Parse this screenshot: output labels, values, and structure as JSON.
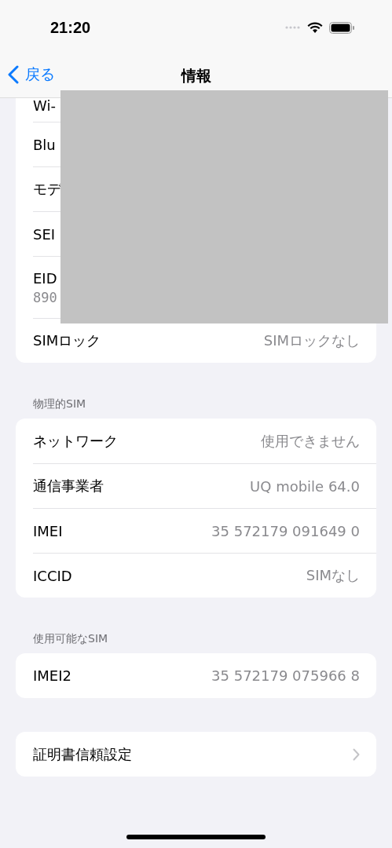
{
  "status_bar": {
    "time": "21:20"
  },
  "nav": {
    "back_label": "戻る",
    "title": "情報"
  },
  "sections": [
    {
      "rows": [
        {
          "kind": "value",
          "label": "Wi-"
        },
        {
          "kind": "value",
          "label": "Blu"
        },
        {
          "kind": "value",
          "label": "モデ"
        },
        {
          "kind": "value",
          "label": "SEI"
        },
        {
          "kind": "value",
          "label": "EID",
          "subvalue": "890"
        },
        {
          "kind": "value",
          "label": "SIMロック",
          "value": "SIMロックなし"
        }
      ]
    },
    {
      "header": "物理的SIM",
      "rows": [
        {
          "kind": "value",
          "label": "ネットワーク",
          "value": "使用できません"
        },
        {
          "kind": "value",
          "label": "通信事業者",
          "value": "UQ mobile 64.0"
        },
        {
          "kind": "value",
          "label": "IMEI",
          "value": "35 572179 091649 0"
        },
        {
          "kind": "value",
          "label": "ICCID",
          "value": "SIMなし"
        }
      ]
    },
    {
      "header": "使用可能なSIM",
      "rows": [
        {
          "kind": "value",
          "label": "IMEI2",
          "value": "35 572179 075966 8"
        }
      ]
    },
    {
      "rows": [
        {
          "kind": "link",
          "label": "証明書信頼設定"
        }
      ]
    }
  ]
}
